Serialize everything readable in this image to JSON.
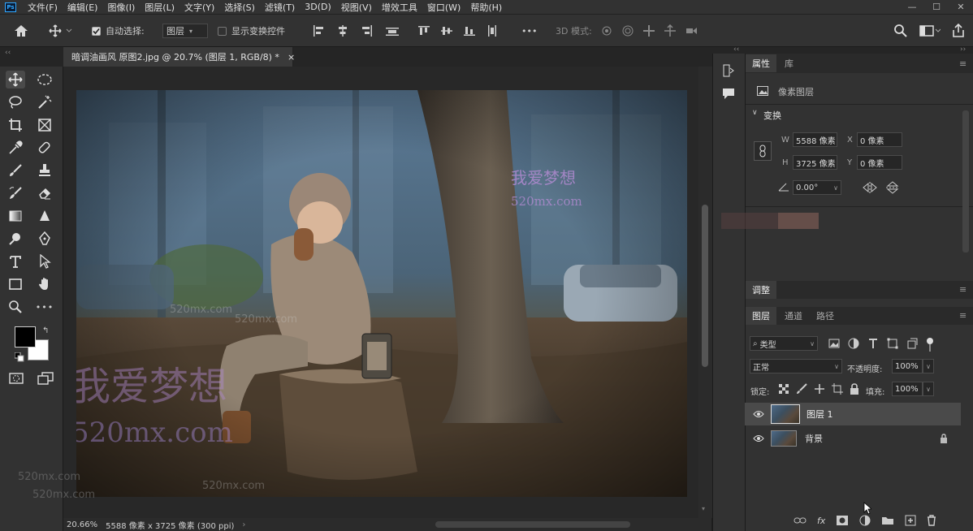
{
  "menubar": {
    "logo": "Ps",
    "items": [
      "文件(F)",
      "编辑(E)",
      "图像(I)",
      "图层(L)",
      "文字(Y)",
      "选择(S)",
      "滤镜(T)",
      "3D(D)",
      "视图(V)",
      "增效工具",
      "窗口(W)",
      "帮助(H)"
    ],
    "window_controls": [
      "—",
      "☐",
      "✕"
    ]
  },
  "options": {
    "auto_select_label": "自动选择:",
    "auto_select_target": "图层",
    "show_transform_label": "显示变换控件",
    "mode_3d_label": "3D 模式:",
    "more": "•••"
  },
  "document": {
    "tab_title": "暗调油画风 原图2.jpg @ 20.7% (图层 1, RGB/8) *",
    "close": "×",
    "zoom": "20.66%",
    "info": "5588 像素 x 3725 像素 (300 ppi)",
    "watermark_cn": "我爱梦想",
    "watermark_en": "520mx.com"
  },
  "properties": {
    "tabs": [
      "属性",
      "库"
    ],
    "type": "像素图层",
    "section": "变换",
    "w_label": "W",
    "w_value": "5588 像素",
    "h_label": "H",
    "h_value": "3725 像素",
    "x_label": "X",
    "x_value": "0 像素",
    "y_label": "Y",
    "y_value": "0 像素",
    "angle": "0.00°"
  },
  "adjust": {
    "title": "调整"
  },
  "layers_panel": {
    "tabs": [
      "图层",
      "通道",
      "路径"
    ],
    "filter": "类型",
    "blend_mode": "正常",
    "opacity_label": "不透明度:",
    "opacity_value": "100%",
    "lock_label": "锁定:",
    "fill_label": "填充:",
    "fill_value": "100%",
    "layers": [
      {
        "name": "图层 1",
        "visible": true,
        "selected": true,
        "locked": false
      },
      {
        "name": "背景",
        "visible": true,
        "selected": false,
        "locked": true
      }
    ],
    "footer_fx": "fx"
  },
  "colors": {
    "accent": "#31a8ff",
    "foreground": "#000000",
    "background": "#ffffff",
    "watermark": "#b08ad0"
  }
}
